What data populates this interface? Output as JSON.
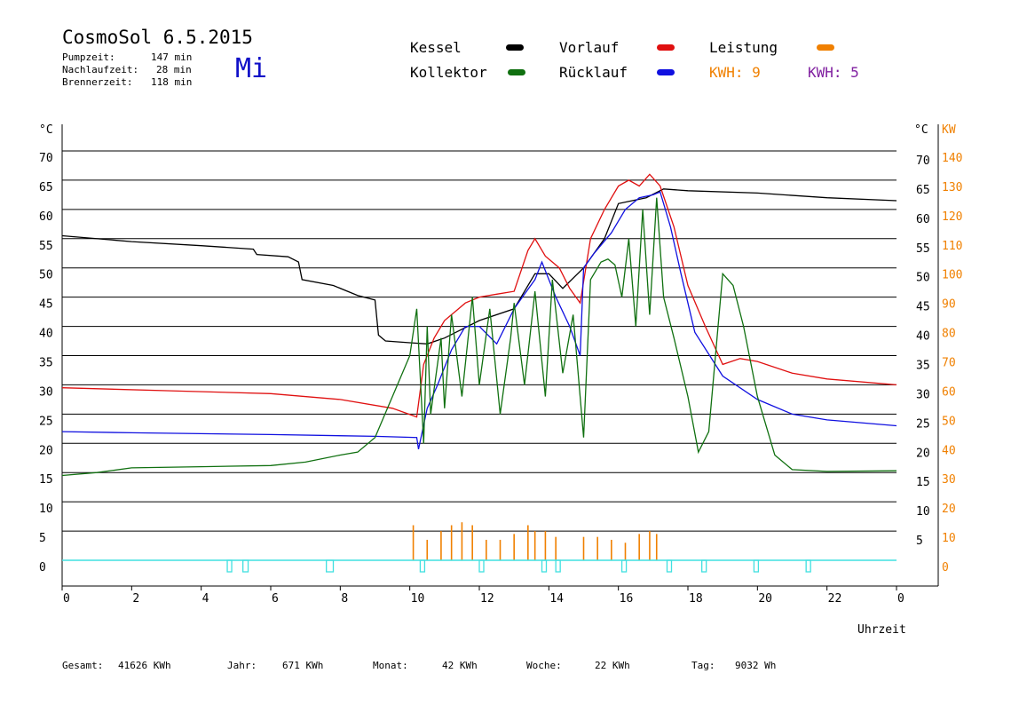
{
  "header": {
    "title": "CosmoSol 6.5.2015",
    "weekday": "Mi",
    "stats": [
      {
        "label": "Pumpzeit:",
        "value": "147 min"
      },
      {
        "label": "Nachlaufzeit:",
        "value": "28 min"
      },
      {
        "label": "Brennerzeit:",
        "value": "118 min"
      }
    ]
  },
  "legend": [
    {
      "label": "Kessel",
      "color": "#000000"
    },
    {
      "label": "Vorlauf",
      "color": "#e01010"
    },
    {
      "label": "Leistung",
      "color": "#f08000"
    },
    {
      "label": "Kollektor",
      "color": "#107010"
    },
    {
      "label": "Rücklauf",
      "color": "#1010e0"
    }
  ],
  "kwh": [
    {
      "label": "KWH: 9",
      "color": "#f08000"
    },
    {
      "label": "KWH: 5",
      "color": "#8020a0"
    }
  ],
  "colors": {
    "grid": "#000000",
    "pump": "#40e0e0",
    "leistung": "#f08000",
    "burner": "#000000",
    "kwh2": "#8020a0"
  },
  "footer": {
    "gesamt_label": "Gesamt:",
    "gesamt_value": "41626 KWh",
    "jahr_label": "Jahr:",
    "jahr_value": "671 KWh",
    "monat_label": "Monat:",
    "monat_value": "42 KWh",
    "woche_label": "Woche:",
    "woche_value": "22 KWh",
    "tag_label": "Tag:",
    "tag_value": "9032 Wh"
  },
  "chart_data": {
    "type": "line",
    "xlabel": "Uhrzeit",
    "ylabel_left": "°C",
    "ylabel_right": [
      "°C",
      "KW"
    ],
    "xlim": [
      0,
      24
    ],
    "ylim": [
      0,
      70
    ],
    "x_ticks": [
      "0",
      "2",
      "4",
      "6",
      "8",
      "10",
      "12",
      "14",
      "16",
      "18",
      "20",
      "22",
      "0"
    ],
    "y_ticks_left": [
      0,
      5,
      10,
      15,
      20,
      25,
      30,
      35,
      40,
      45,
      50,
      55,
      60,
      65,
      70
    ],
    "y_ticks_right": [
      5,
      10,
      15,
      20,
      25,
      30,
      35,
      40,
      45,
      50,
      55,
      60,
      65,
      70
    ],
    "y_ticks_kw": [
      0,
      10,
      20,
      30,
      40,
      50,
      60,
      70,
      80,
      90,
      100,
      110,
      120,
      130,
      140
    ],
    "grid": true,
    "series": [
      {
        "name": "Kessel",
        "color": "#000000",
        "x": [
          0,
          2,
          4,
          5.5,
          5.6,
          6.5,
          6.8,
          6.9,
          7.8,
          8.5,
          9.0,
          9.1,
          9.3,
          10.0,
          10.5,
          11.0,
          12.0,
          13.0,
          13.6,
          14.0,
          14.4,
          15.0,
          15.6,
          16.0,
          16.4,
          16.8,
          17.3,
          18.0,
          20.0,
          22.0,
          24.0
        ],
        "y": [
          55.5,
          54.5,
          53.8,
          53.2,
          52.3,
          51.9,
          51.0,
          48.0,
          47.0,
          45.3,
          44.5,
          38.5,
          37.5,
          37.2,
          37.0,
          38.0,
          41.0,
          43.0,
          49.0,
          49.0,
          46.5,
          50.0,
          55.0,
          61.0,
          61.5,
          62.0,
          63.5,
          63.2,
          62.8,
          62.0,
          61.5
        ]
      },
      {
        "name": "Vorlauf",
        "color": "#e01010",
        "x": [
          0,
          3,
          6,
          8,
          9.5,
          10.2,
          10.4,
          10.7,
          11.0,
          11.3,
          11.6,
          12.0,
          12.5,
          13.0,
          13.4,
          13.6,
          13.9,
          14.3,
          14.6,
          14.9,
          15.2,
          15.6,
          16.0,
          16.3,
          16.6,
          16.9,
          17.2,
          17.6,
          18.0,
          18.5,
          19.0,
          19.5,
          20.0,
          21.0,
          22.0,
          24.0
        ],
        "y": [
          29.5,
          29.0,
          28.5,
          27.5,
          26.0,
          24.5,
          33.5,
          38.0,
          41.0,
          42.5,
          44.0,
          45.0,
          45.5,
          46.0,
          53.0,
          55.0,
          52.0,
          50.0,
          46.5,
          44.0,
          55.0,
          60.0,
          64.0,
          65.0,
          64.0,
          66.0,
          64.0,
          57.0,
          47.0,
          40.0,
          33.5,
          34.5,
          34.0,
          32.0,
          31.0,
          30.0
        ]
      },
      {
        "name": "Rücklauf",
        "color": "#1010e0",
        "x": [
          0,
          2,
          6,
          9,
          10.2,
          10.25,
          10.5,
          10.8,
          11.2,
          11.6,
          12.0,
          12.5,
          13.0,
          13.3,
          13.6,
          13.8,
          14.2,
          14.6,
          14.9,
          15.0,
          15.3,
          15.8,
          16.2,
          16.6,
          17.0,
          17.2,
          17.5,
          17.8,
          18.2,
          19.0,
          20.0,
          21.0,
          22.0,
          24.0
        ],
        "y": [
          22.0,
          21.8,
          21.5,
          21.2,
          21.0,
          19.0,
          26.0,
          30.0,
          36.0,
          40.0,
          40.0,
          37.0,
          43.0,
          45.5,
          48.0,
          51.0,
          45.0,
          40.0,
          35.0,
          50.0,
          52.5,
          56.0,
          60.0,
          62.0,
          62.5,
          63.0,
          57.0,
          49.0,
          39.0,
          31.5,
          27.5,
          25.0,
          24.0,
          23.0
        ]
      },
      {
        "name": "Kollektor",
        "color": "#107010",
        "x": [
          0,
          1,
          2,
          4,
          6,
          7,
          8,
          8.5,
          9.0,
          9.5,
          10.0,
          10.2,
          10.4,
          10.5,
          10.6,
          10.9,
          11.0,
          11.2,
          11.5,
          11.8,
          12.0,
          12.3,
          12.6,
          12.9,
          13.0,
          13.3,
          13.6,
          13.9,
          14.1,
          14.4,
          14.7,
          15.0,
          15.2,
          15.5,
          15.7,
          15.9,
          16.1,
          16.3,
          16.5,
          16.7,
          16.9,
          17.1,
          17.3,
          17.6,
          18.0,
          18.3,
          18.6,
          19.0,
          19.3,
          19.6,
          20.0,
          20.5,
          21.0,
          22.0,
          24.0
        ],
        "y": [
          14.5,
          15.0,
          15.8,
          16.0,
          16.2,
          16.8,
          18.0,
          18.5,
          21.0,
          28.0,
          35.0,
          43.0,
          20.0,
          40.0,
          25.0,
          38.0,
          26.0,
          42.0,
          28.0,
          45.0,
          30.0,
          43.0,
          25.0,
          38.0,
          44.0,
          30.0,
          46.0,
          28.0,
          48.0,
          32.0,
          42.0,
          21.0,
          48.0,
          51.0,
          51.5,
          50.5,
          45.0,
          55.0,
          40.0,
          60.0,
          42.0,
          62.0,
          45.0,
          38.0,
          28.0,
          18.5,
          22.0,
          49.0,
          47.0,
          40.0,
          28.0,
          18.0,
          15.5,
          15.2,
          15.3
        ]
      }
    ],
    "power_series": {
      "name": "Leistung",
      "x": [
        10.1,
        10.5,
        10.9,
        11.2,
        11.5,
        11.8,
        12.2,
        12.6,
        13.0,
        13.4,
        13.6,
        13.9,
        14.2,
        15.0,
        15.4,
        15.8,
        16.2,
        16.6,
        16.9,
        17.1
      ],
      "y": [
        12,
        7,
        10,
        12,
        13,
        12,
        7,
        7,
        9,
        12,
        10,
        10,
        8,
        8,
        8,
        7,
        6,
        9,
        10,
        9
      ]
    },
    "burner_periods": [
      [
        4.75,
        4.85
      ],
      [
        5.2,
        5.35
      ],
      [
        7.6,
        7.8
      ],
      [
        10.3,
        10.4
      ],
      [
        12.0,
        12.1
      ],
      [
        13.8,
        13.9
      ],
      [
        14.2,
        14.3
      ],
      [
        16.1,
        16.2
      ],
      [
        17.4,
        17.5
      ],
      [
        18.4,
        18.5
      ],
      [
        19.9,
        20.0
      ],
      [
        21.4,
        21.5
      ]
    ]
  }
}
